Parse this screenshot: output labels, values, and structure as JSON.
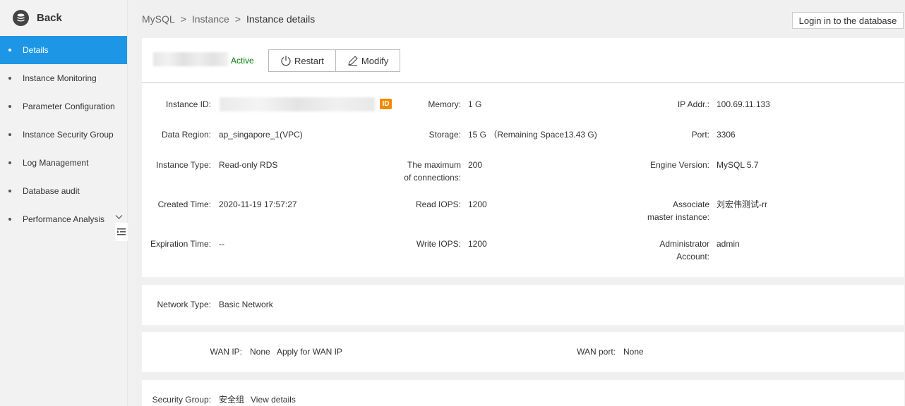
{
  "sidebar": {
    "back_label": "Back",
    "items": [
      {
        "label": "Details",
        "active": true
      },
      {
        "label": "Instance Monitoring"
      },
      {
        "label": "Parameter Configuration"
      },
      {
        "label": "Instance Security Group"
      },
      {
        "label": "Log Management"
      },
      {
        "label": "Database audit"
      },
      {
        "label": "Performance Analysis"
      }
    ]
  },
  "breadcrumb": [
    "MySQL",
    "Instance",
    "Instance details"
  ],
  "breadcrumb_sep": ">",
  "login_button": "Login in to the database",
  "header": {
    "status": "Active",
    "restart_label": "Restart",
    "modify_label": "Modify"
  },
  "details": {
    "instance_id": {
      "label": "Instance ID:",
      "badge": "ID"
    },
    "data_region": {
      "label": "Data Region:",
      "value": "ap_singapore_1(VPC)"
    },
    "instance_type": {
      "label": "Instance Type:",
      "value": "Read-only RDS"
    },
    "created_time": {
      "label": "Created Time:",
      "value": "2020-11-19 17:57:27"
    },
    "expiration_time": {
      "label": "Expiration Time:",
      "value": "--"
    },
    "memory": {
      "label": "Memory:",
      "value": "1 G"
    },
    "storage": {
      "label": "Storage:",
      "value": "15 G （Remaining Space13.43 G)"
    },
    "max_connections": {
      "label_line1": "The maximum",
      "label_line2": "of connections:",
      "value": "200"
    },
    "read_iops": {
      "label": "Read IOPS:",
      "value": "1200"
    },
    "write_iops": {
      "label": "Write IOPS:",
      "value": "1200"
    },
    "ip_addr": {
      "label": "IP Addr.:",
      "value": "100.69.11.133"
    },
    "port": {
      "label": "Port:",
      "value": "3306"
    },
    "engine_version": {
      "label": "Engine Version:",
      "value": "MySQL 5.7"
    },
    "master_instance": {
      "label_line1": "Associate",
      "label_line2": "master instance:",
      "value": "刘宏伟测试-rr"
    },
    "admin_account": {
      "label_line1": "Administrator",
      "label_line2": "Account:",
      "value": "admin"
    }
  },
  "network": {
    "label": "Network Type:",
    "value": "Basic Network"
  },
  "wan": {
    "ip_label": "WAN IP:",
    "ip_value": "None",
    "apply_link": "Apply for WAN IP",
    "port_label": "WAN port:",
    "port_value": "None"
  },
  "security": {
    "label": "Security Group:",
    "value": "安全组",
    "link": "View details"
  },
  "colors": {
    "accent": "#1e96e6",
    "active_status": "#008000",
    "badge": "#f08a00",
    "link": "#1e88e5"
  }
}
